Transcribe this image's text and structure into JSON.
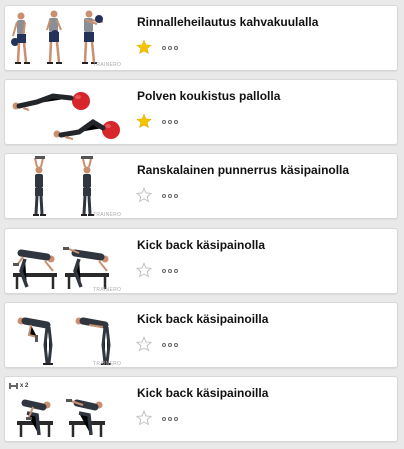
{
  "exercises": [
    {
      "title": "Rinnalleheilautus kahvakuulalla",
      "favorite": true,
      "watermark": "TRAINERO",
      "more_icon": "more-dots-icon"
    },
    {
      "title": "Polven koukistus pallolla",
      "favorite": true,
      "watermark": "",
      "more_icon": "more-dots-icon"
    },
    {
      "title": "Ranskalainen punnerrus käsipainolla",
      "favorite": false,
      "watermark": "TRAINERO",
      "more_icon": "more-dots-icon"
    },
    {
      "title": "Kick back käsipainolla",
      "favorite": false,
      "watermark": "TRAINERO",
      "more_icon": "more-dots-icon"
    },
    {
      "title": "Kick back käsipainoilla",
      "favorite": false,
      "watermark": "TRAINERO",
      "more_icon": "more-dots-icon"
    },
    {
      "title": "Kick back käsipainoilla",
      "favorite": false,
      "watermark": "",
      "badge": "x 2",
      "more_icon": "more-dots-icon"
    }
  ],
  "colors": {
    "star_active": "#f5c400",
    "star_inactive": "#bdbdbd",
    "ball": "#d6262c",
    "skin": "#c98f6e",
    "shirt": "#2f3640",
    "card_bg": "#ffffff",
    "page_bg": "#e9e9e9"
  }
}
